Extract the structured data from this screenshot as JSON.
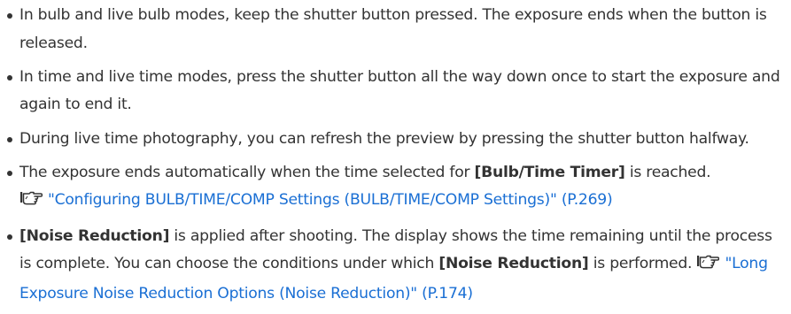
{
  "bullets": [
    {
      "text": "In bulb and live bulb modes, keep the shutter button pressed. The exposure ends when the button is released."
    },
    {
      "text": "In time and live time modes, press the shutter button all the way down once to start the exposure and again to end it."
    },
    {
      "text": "During live time photography, you can refresh the preview by pressing the shutter button halfway."
    },
    {
      "before": "The exposure ends automatically when the time selected for ",
      "bold": "[Bulb/Time Timer]",
      "after": " is reached.",
      "ref_icon": "pointing-hand-reference-icon",
      "link": "\"Configuring BULB/TIME/COMP Settings (BULB/TIME/COMP Settings)\" (P.269)"
    },
    {
      "bold1": "[Noise Reduction]",
      "middle": " is applied after shooting. The display shows the time remaining until the process is complete. You can choose the conditions under which ",
      "bold2": "[Noise Reduction]",
      "after": " is performed.",
      "ref_icon": "pointing-hand-reference-icon",
      "link": "\"Long Exposure Noise Reduction Options (Noise Reduction)\" (P.174)"
    }
  ],
  "colors": {
    "text": "#333333",
    "link": "#1a6fd4"
  }
}
